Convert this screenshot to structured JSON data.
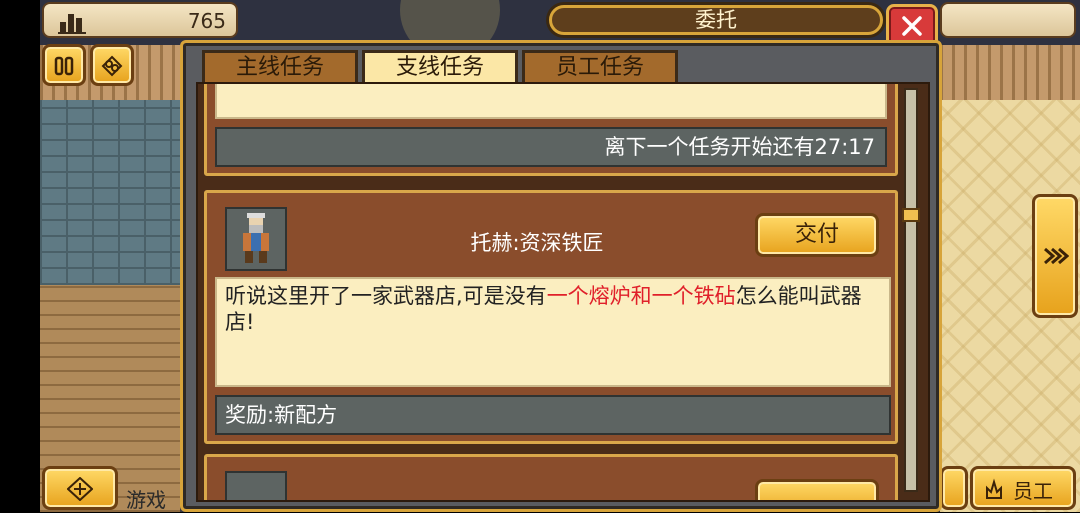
{
  "hud": {
    "money": "765",
    "bottom_hint": "游戏",
    "staff_label": "员工"
  },
  "dialog": {
    "title": "委托",
    "tabs": [
      {
        "label": "主线任务",
        "active": false
      },
      {
        "label": "支线任务",
        "active": true
      },
      {
        "label": "员工任务",
        "active": false
      }
    ],
    "timer_text": "离下一个任务开始还有27:17",
    "quest": {
      "npc_name": "托赫:资深铁匠",
      "deliver_label": "交付",
      "desc_before": "听说这里开了一家武器店,可是没有",
      "desc_highlight": "一个熔炉和一个铁砧",
      "desc_after": "怎么能叫武器店!",
      "reward": "奖励:新配方"
    }
  },
  "colors": {
    "highlight": "#e0202a",
    "gold_button": "#f3be3c",
    "close_red": "#d83a3a"
  },
  "icons": [
    "stats-icon",
    "pause-icon",
    "view-icon",
    "move-icon",
    "arrow-right-icon",
    "staff-icon",
    "close-icon"
  ]
}
